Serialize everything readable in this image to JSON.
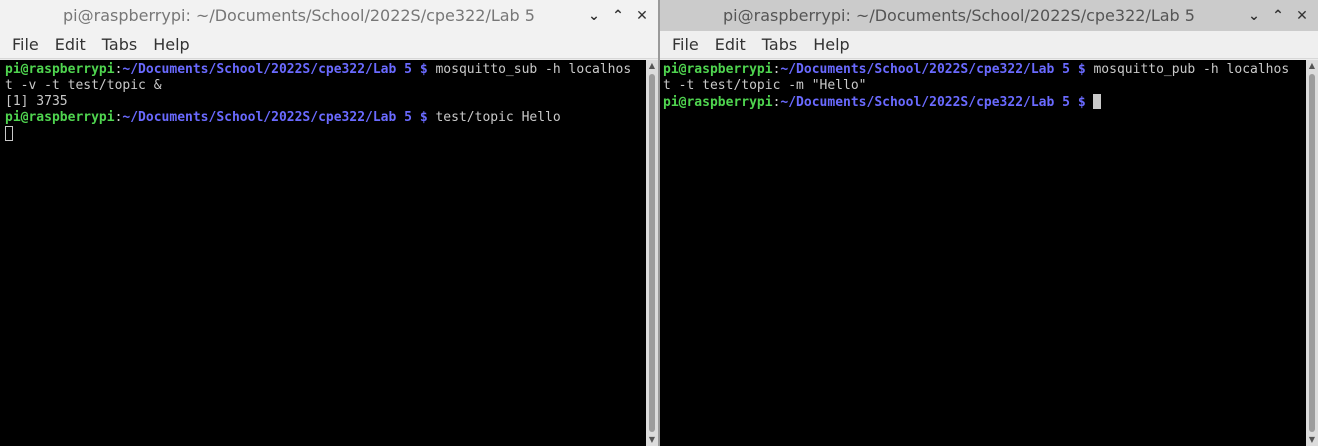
{
  "left": {
    "title": "pi@raspberrypi: ~/Documents/School/2022S/cpe322/Lab 5",
    "menu": [
      "File",
      "Edit",
      "Tabs",
      "Help"
    ],
    "prompt_user": "pi@raspberrypi",
    "prompt_colon": ":",
    "prompt_path": "~/Documents/School/2022S/cpe322/Lab 5 $",
    "line1_cmd": " mosquitto_sub -h localhos",
    "line2": "t -v -t test/topic &",
    "line3": "[1] 3735",
    "line4_cmd": " test/topic Hello"
  },
  "right": {
    "title": "pi@raspberrypi: ~/Documents/School/2022S/cpe322/Lab 5",
    "menu": [
      "File",
      "Edit",
      "Tabs",
      "Help"
    ],
    "prompt_user": "pi@raspberrypi",
    "prompt_colon": ":",
    "prompt_path": "~/Documents/School/2022S/cpe322/Lab 5 $",
    "line1_cmd": " mosquitto_pub -h localhos",
    "line2": "t -t test/topic -m \"Hello\"",
    "line3_cmd": " "
  },
  "icons": {
    "minimize": "chevron-down-icon",
    "maximize": "chevron-up-icon",
    "close": "close-icon"
  }
}
